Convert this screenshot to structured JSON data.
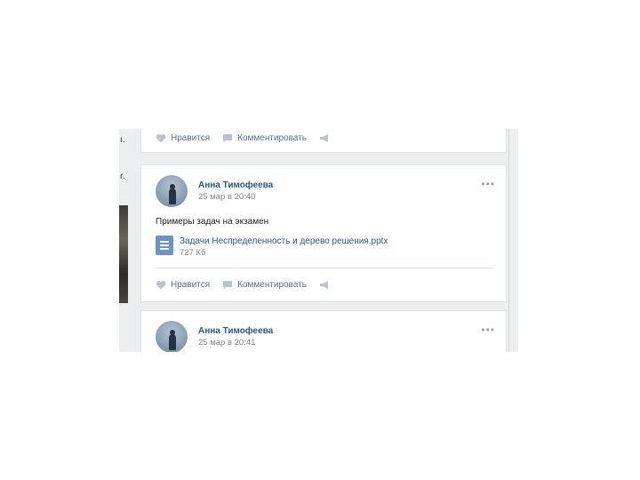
{
  "left_fragments": [
    "ı.",
    "ɾ."
  ],
  "posts": [
    {
      "actions": {
        "like": "Нравится",
        "comment": "Комментировать"
      }
    },
    {
      "author": "Анна Тимофеева",
      "date": "25 мар в 20:40",
      "text": "Примеры задач на экзамен",
      "attachment": {
        "name": "Задачи Неспределенность и дерево решения.pptx",
        "size": "727 Кб"
      },
      "actions": {
        "like": "Нравится",
        "comment": "Комментировать"
      }
    },
    {
      "author": "Анна Тимофеева",
      "date": "25 мар в 20:41"
    }
  ],
  "icons": {
    "like": "heart-icon",
    "comment": "comment-icon",
    "share": "share-megaphone-icon",
    "more": "more-dots-icon",
    "doc": "document-icon"
  },
  "colors": {
    "link": "#2a5885",
    "action": "#57708f",
    "doc_icon": "#6a93c6",
    "background": "#edeef0"
  }
}
